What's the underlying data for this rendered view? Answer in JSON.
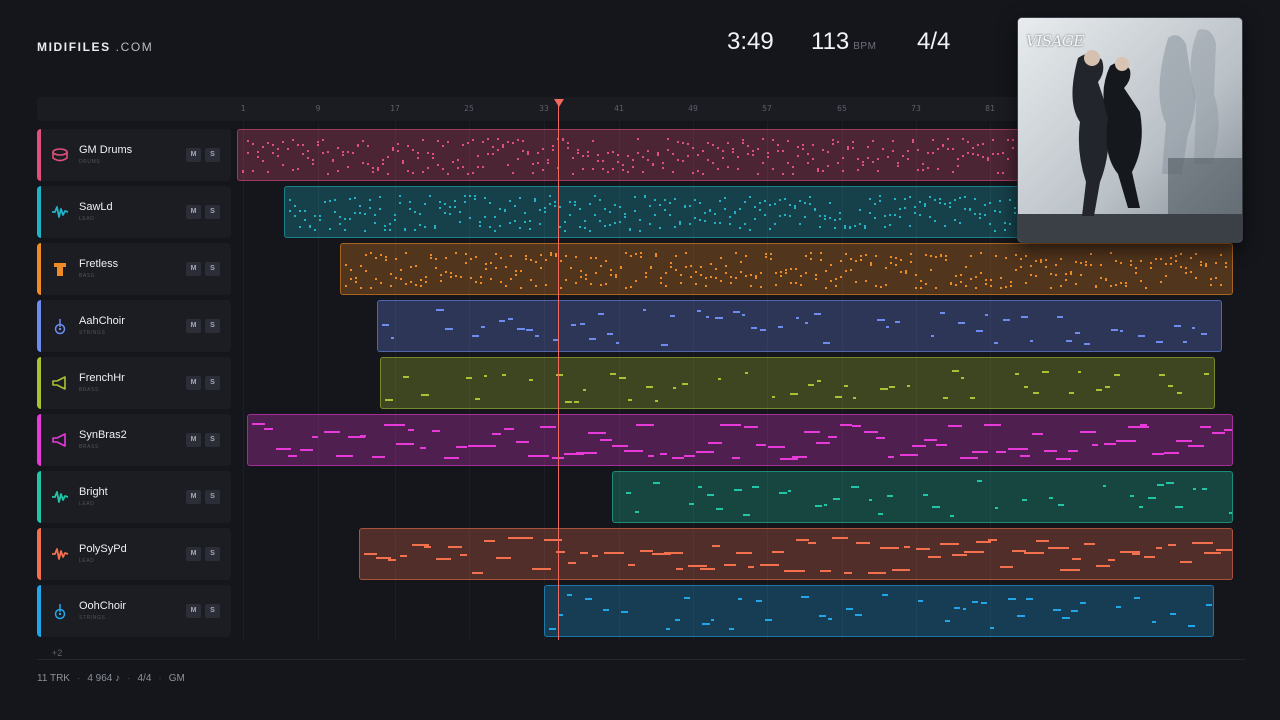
{
  "brand": {
    "name": "MIDIFILES",
    "suffix": ".COM"
  },
  "stats": {
    "time": "3:49",
    "bpm": "113",
    "bpm_unit": "BPM",
    "signature": "4/4"
  },
  "ruler": {
    "ticks": [
      "1",
      "9",
      "17",
      "25",
      "33",
      "41",
      "49",
      "57",
      "65",
      "73",
      "81"
    ]
  },
  "tracks": [
    {
      "name": "GM Drums",
      "category": "DRUMS",
      "color": "#e0507a",
      "icon": "drum-icon",
      "mute": "M",
      "solo": "S"
    },
    {
      "name": "SawLd",
      "category": "LEAD",
      "color": "#1fb3c4",
      "icon": "waveform-icon",
      "mute": "M",
      "solo": "S"
    },
    {
      "name": "Fretless",
      "category": "BASS",
      "color": "#f08a24",
      "icon": "bass-icon",
      "mute": "M",
      "solo": "S"
    },
    {
      "name": "AahChoir",
      "category": "STRINGS",
      "color": "#6e8cf0",
      "icon": "guitar-icon",
      "mute": "M",
      "solo": "S"
    },
    {
      "name": "FrenchHr",
      "category": "BRASS",
      "color": "#a8c234",
      "icon": "horn-icon",
      "mute": "M",
      "solo": "S"
    },
    {
      "name": "SynBras2",
      "category": "BRASS",
      "color": "#e83ad8",
      "icon": "horn-icon",
      "mute": "M",
      "solo": "S"
    },
    {
      "name": "Bright",
      "category": "LEAD",
      "color": "#22c6a6",
      "icon": "waveform-icon",
      "mute": "M",
      "solo": "S"
    },
    {
      "name": "PolySyPd",
      "category": "LEAD",
      "color": "#f2704e",
      "icon": "waveform-icon",
      "mute": "M",
      "solo": "S"
    },
    {
      "name": "OohChoir",
      "category": "STRINGS",
      "color": "#22a6ea",
      "icon": "guitar-icon",
      "mute": "M",
      "solo": "S"
    }
  ],
  "more_tracks": "+2",
  "footer": {
    "tracks": "11 TRK",
    "notes": "4 964 ♪",
    "signature": "4/4",
    "standard": "GM"
  },
  "album": {
    "title": "VISAGE"
  },
  "colors": {
    "background": "#14161b",
    "playhead": "#f26a5e"
  }
}
